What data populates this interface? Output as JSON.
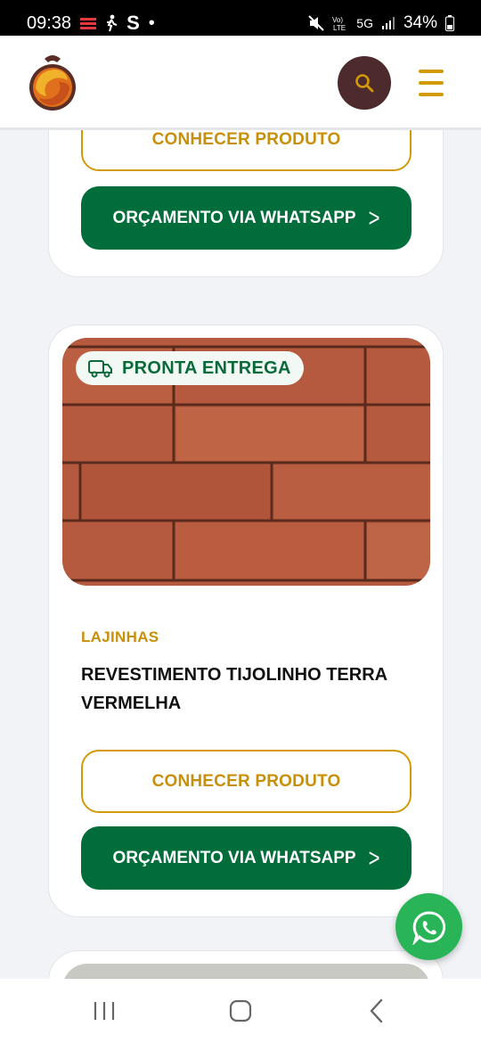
{
  "status_bar": {
    "time": "09:38",
    "app_letter": "S",
    "dot": "•",
    "battery": "34%",
    "network": "5G"
  },
  "header": {
    "logo_icon": "brand-logo",
    "search_icon": "search-icon",
    "menu_icon": "hamburger-icon"
  },
  "top_card": {
    "know_button": "CONHECER PRODUTO",
    "whatsapp_button": "ORÇAMENTO VIA WHATSAPP"
  },
  "product": {
    "badge": "PRONTA ENTREGA",
    "badge_icon": "truck-icon",
    "category": "LAJINHAS",
    "title": "REVESTIMENTO TIJOLINHO TERRA VERMELHA",
    "know_button": "CONHECER PRODUTO",
    "whatsapp_button": "ORÇAMENTO VIA WHATSAPP"
  },
  "colors": {
    "brand_gold": "#d19a06",
    "brand_green": "#006d3a",
    "brand_brown": "#4d2a2c",
    "whatsapp_green": "#29b557"
  },
  "fab": {
    "icon": "whatsapp-icon"
  },
  "nav": {
    "recents_icon": "recents-icon",
    "home_icon": "home-icon",
    "back_icon": "back-icon"
  }
}
